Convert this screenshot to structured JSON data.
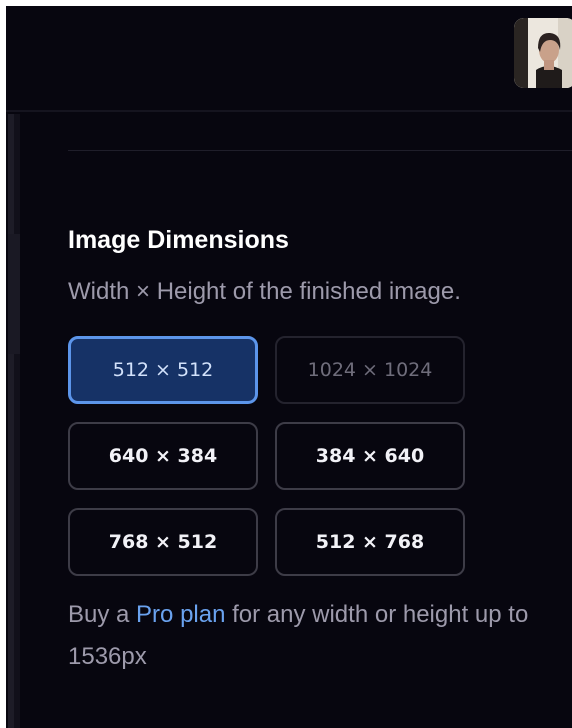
{
  "section": {
    "title": "Image Dimensions",
    "subtitle": "Width × Height of the finished image."
  },
  "dimensions": {
    "options": [
      "512 × 512",
      "1024 × 1024",
      "640 × 384",
      "384 × 640",
      "768 × 512",
      "512 × 768"
    ],
    "selected": "512 × 512",
    "disabled": [
      "1024 × 1024"
    ]
  },
  "promo": {
    "prefix": "Buy a ",
    "link_label": "Pro plan",
    "suffix": " for any width or height up to 1536px"
  },
  "colors": {
    "background": "#07060f",
    "accent": "#5c95ea",
    "link": "#6aa2ef",
    "selected_fill": "#163266"
  }
}
